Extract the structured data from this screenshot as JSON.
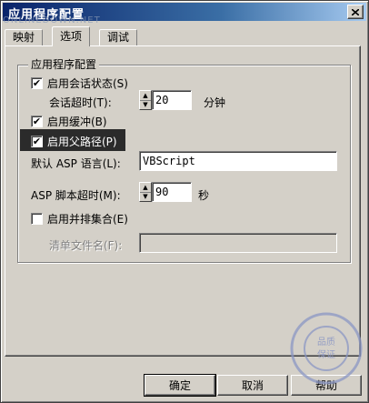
{
  "window": {
    "title": "应用程序配置"
  },
  "tabs": [
    {
      "label": "映射",
      "active": false
    },
    {
      "label": "选项",
      "active": true
    },
    {
      "label": "调试",
      "active": false
    }
  ],
  "group": {
    "title": "应用程序配置"
  },
  "options": {
    "session_state": {
      "label": "启用会话状态(S)",
      "checked": true
    },
    "session_timeout": {
      "label": "会话超时(T):",
      "value": "20",
      "unit": "分钟"
    },
    "buffering": {
      "label": "启用缓冲(B)",
      "checked": true
    },
    "parent_paths": {
      "label": "启用父路径(P)",
      "checked": true
    },
    "default_language": {
      "label": "默认 ASP 语言(L):",
      "value": "VBScript"
    },
    "script_timeout": {
      "label": "ASP 脚本超时(M):",
      "value": "90",
      "unit": "秒"
    },
    "side_by_side": {
      "label": "启用并排集合(E)",
      "checked": false
    },
    "manifest_file": {
      "label": "清单文件名(F):",
      "value": ""
    }
  },
  "buttons": {
    "ok": "确定",
    "cancel": "取消",
    "help": "帮助"
  },
  "watermark": {
    "site": "ONLINEDOWN.NET",
    "text": "品质保证"
  }
}
